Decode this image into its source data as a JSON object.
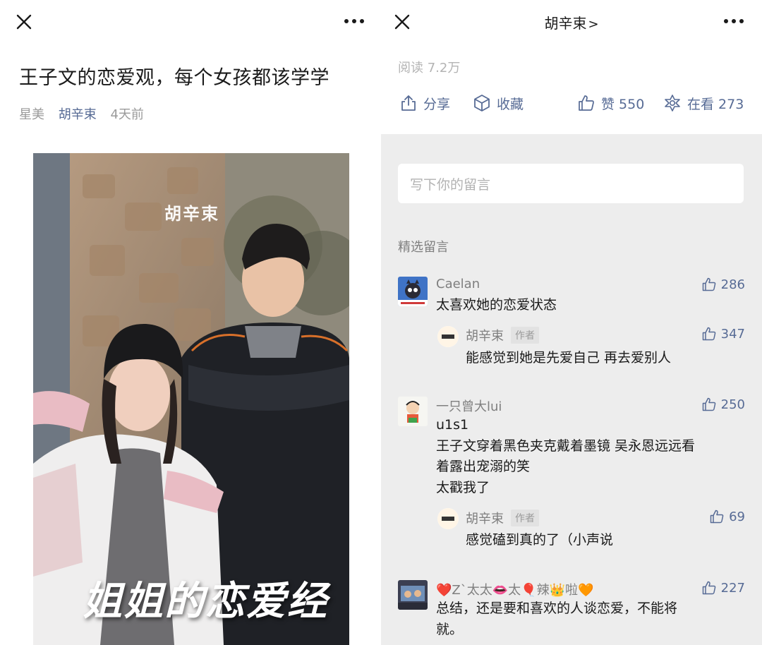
{
  "left": {
    "title": "王子文的恋爱观，每个女孩都该学学",
    "meta": {
      "source": "星美",
      "author": "胡辛束",
      "time": "4天前"
    },
    "cover": {
      "watermark": "胡辛束",
      "caption": "姐姐的恋爱经"
    }
  },
  "right": {
    "nav_title": "胡辛束",
    "nav_arrow": ">",
    "read_count": "阅读 7.2万",
    "actions": {
      "share": "分享",
      "favorite": "收藏",
      "like": "赞 550",
      "watching": "在看 273"
    },
    "comment_placeholder": "写下你的留言",
    "section_title": "精选留言",
    "comments": [
      {
        "nick": "Caelan",
        "likes": "286",
        "text": "太喜欢她的恋爱状态",
        "reply": {
          "nick": "胡辛束",
          "tag": "作者",
          "likes": "347",
          "text": "能感觉到她是先爱自己 再去爱别人"
        }
      },
      {
        "nick": "一只曾大lui",
        "likes": "250",
        "lines": [
          "u1s1",
          "王子文穿着黑色夹克戴着墨镜 吴永恩远远看",
          "着露出宠溺的笑",
          "太戳我了"
        ],
        "reply": {
          "nick": "胡辛束",
          "tag": "作者",
          "likes": "69",
          "text": "感觉磕到真的了（小声说"
        }
      },
      {
        "nick": "❤️Z`太太👄太🎈辣👑啦🧡",
        "likes": "227",
        "lines": [
          "总结，还是要和喜欢的人谈恋爱，不能将",
          "就。"
        ]
      }
    ]
  },
  "colors": {
    "link": "#576b95",
    "muted": "#9a9a9a",
    "comments_bg": "#ededed"
  }
}
